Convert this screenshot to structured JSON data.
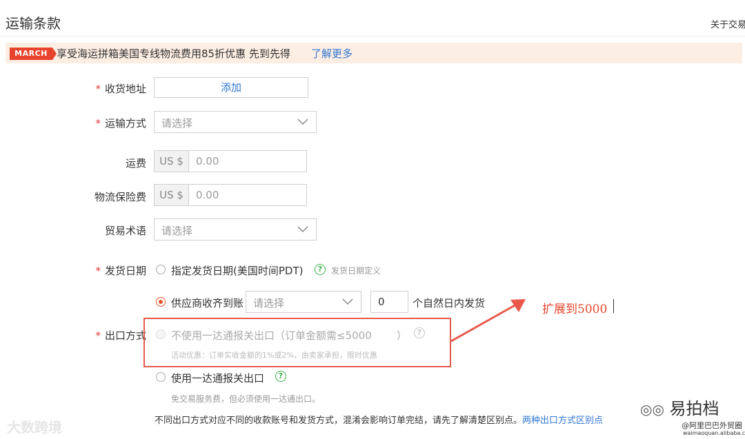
{
  "header": {
    "title": "运输条款",
    "top_right_link": "关于交易"
  },
  "banner": {
    "badge": "MARCH",
    "text": "享受海运拼箱美国专线物流费用85折优惠 先到先得",
    "link": "了解更多",
    "accent": "#e8442d",
    "background": "#fdeee4"
  },
  "form": {
    "required_mark": "*",
    "address": {
      "label": "收货地址",
      "button": "添加"
    },
    "shipping_method": {
      "label": "运输方式",
      "placeholder": "请选择"
    },
    "freight": {
      "label": "运费",
      "currency": "US $",
      "value": "0.00"
    },
    "insurance": {
      "label": "物流保险费",
      "currency": "US $",
      "value": "0.00"
    },
    "trade_terms": {
      "label": "贸易术语",
      "placeholder": "请选择"
    },
    "ship_date": {
      "label": "发货日期",
      "option1": {
        "label": "指定发货日期(美国时间PDT)",
        "help": "发货日期定义",
        "selected": false
      },
      "option2": {
        "label": "供应商收齐到账",
        "select_placeholder": "请选择",
        "days": "0",
        "suffix": "个自然日内发货",
        "selected": true
      }
    },
    "export_method": {
      "label": "出口方式",
      "option1": {
        "label": "不使用一达通报关出口（订单金额需≤5000",
        "close_paren": "）",
        "hint": "活动优惠：订单实收金额的1%或2%，由卖家承担，限时优惠",
        "disabled": true
      },
      "option2": {
        "label": "使用一达通报关出口",
        "hint": "免交易服务费，但必须使用一达通出口。",
        "selected": false
      }
    },
    "footer_note": "不同出口方式对应不同的收款账号和发货方式，混淆会影响订单完结，请先了解清楚区别点。",
    "footer_link": "两种出口方式区别点"
  },
  "annotation": {
    "text": "扩展到5000",
    "color": "#e8442d"
  },
  "watermarks": {
    "left": "大数跨境",
    "right_title": "易拍档",
    "right_handle": "@阿里巴巴外贸圈",
    "right_url": "waimaoquan.alibaba.com"
  }
}
